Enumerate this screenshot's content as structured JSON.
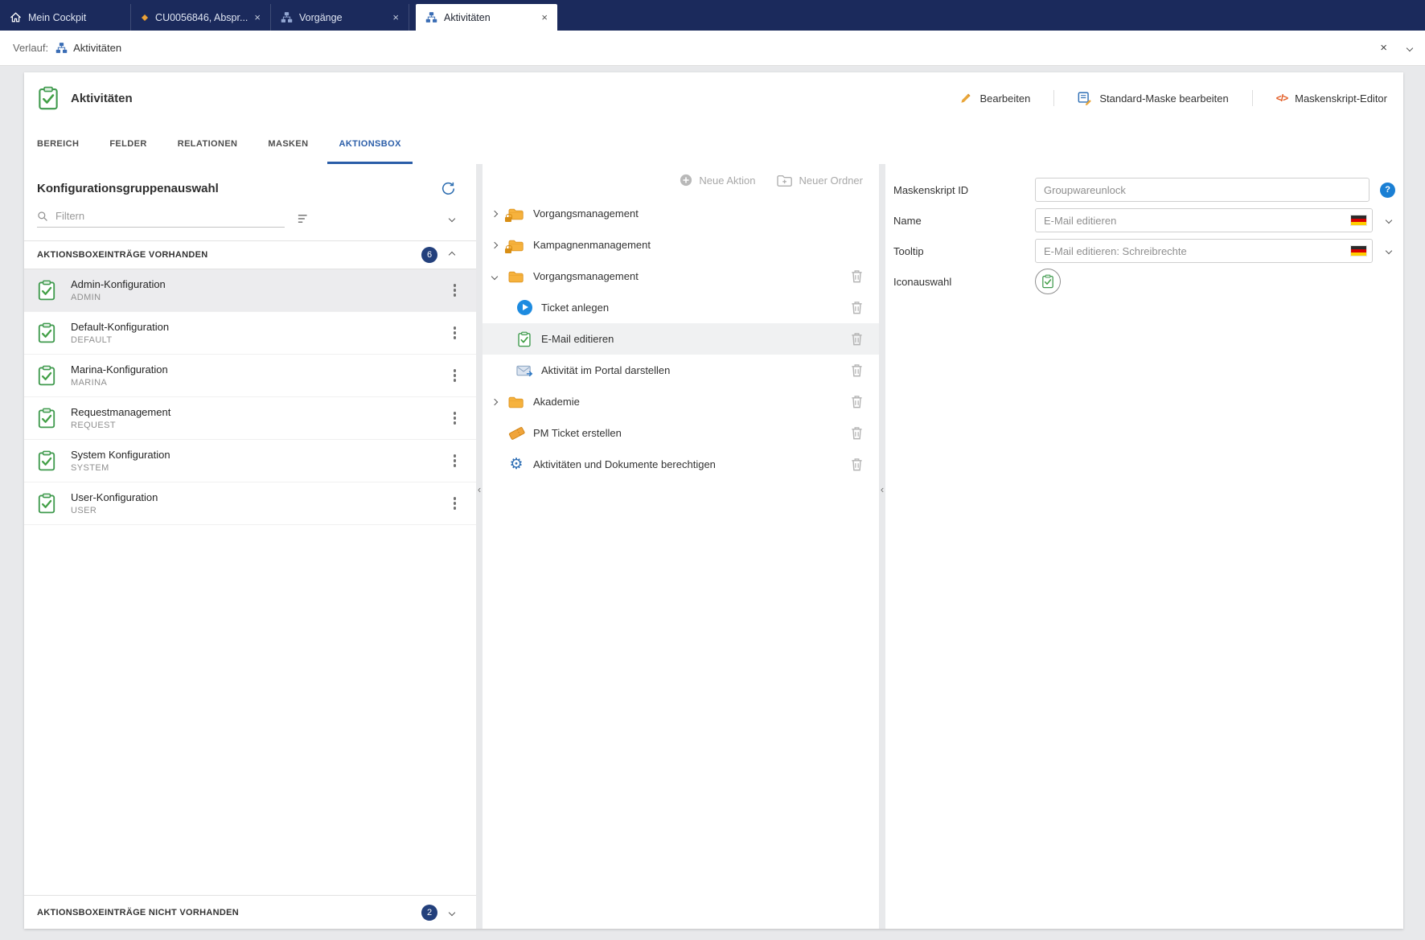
{
  "colors": {
    "topbar": "#1b2a5c",
    "accent_blue": "#2a5da8",
    "badge": "#23407c",
    "green_icon": "#43a047",
    "folder_yellow": "#f6b23d",
    "selection_gray": "#ececee"
  },
  "window_tabs": [
    {
      "label": "Mein Cockpit"
    },
    {
      "label": "CU0056846, Abspr..."
    },
    {
      "label": "Vorgänge"
    },
    {
      "label": "Aktivitäten"
    }
  ],
  "history_bar": {
    "label": "Verlauf:",
    "current": "Aktivitäten"
  },
  "header": {
    "title": "Aktivitäten",
    "actions": {
      "edit": "Bearbeiten",
      "edit_mask": "Standard-Maske bearbeiten",
      "script_editor": "Maskenskript-Editor"
    }
  },
  "nav_tabs": [
    {
      "label": "BEREICH"
    },
    {
      "label": "FELDER"
    },
    {
      "label": "RELATIONEN"
    },
    {
      "label": "MASKEN"
    },
    {
      "label": "AKTIONSBOX"
    }
  ],
  "left_panel": {
    "title": "Konfigurationsgruppenauswahl",
    "filter_placeholder": "Filtern",
    "group_present": {
      "label": "AKTIONSBOXEINTRÄGE VORHANDEN",
      "count": "6"
    },
    "entries": [
      {
        "title": "Admin-Konfiguration",
        "code": "ADMIN"
      },
      {
        "title": "Default-Konfiguration",
        "code": "DEFAULT"
      },
      {
        "title": "Marina-Konfiguration",
        "code": "MARINA"
      },
      {
        "title": "Requestmanagement",
        "code": "REQUEST"
      },
      {
        "title": "System Konfiguration",
        "code": "SYSTEM"
      },
      {
        "title": "User-Konfiguration",
        "code": "USER"
      }
    ],
    "group_absent": {
      "label": "AKTIONSBOXEINTRÄGE NICHT VORHANDEN",
      "count": "2"
    }
  },
  "action_tree": {
    "toolbar": {
      "new_action": "Neue Aktion",
      "new_folder": "Neuer Ordner"
    },
    "nodes": [
      {
        "label": "Vorgangsmanagement"
      },
      {
        "label": "Kampagnenmanagement"
      },
      {
        "label": "Vorgangsmanagement"
      },
      {
        "label": "Ticket anlegen"
      },
      {
        "label": "E-Mail editieren"
      },
      {
        "label": "Aktivität im Portal darstellen"
      },
      {
        "label": "Akademie"
      },
      {
        "label": "PM Ticket erstellen"
      },
      {
        "label": "Aktivitäten und Dokumente berechtigen"
      }
    ]
  },
  "properties": {
    "maskenskript_id": {
      "label": "Maskenskript ID",
      "value": "Groupwareunlock"
    },
    "name": {
      "label": "Name",
      "value": "E-Mail editieren"
    },
    "tooltip": {
      "label": "Tooltip",
      "value": "E-Mail editieren: Schreibrechte"
    },
    "icon": {
      "label": "Iconauswahl"
    }
  },
  "glyphs": {
    "close": "×",
    "collapse": "‹",
    "code": "</>",
    "help": "?",
    "gear": "⚙"
  }
}
